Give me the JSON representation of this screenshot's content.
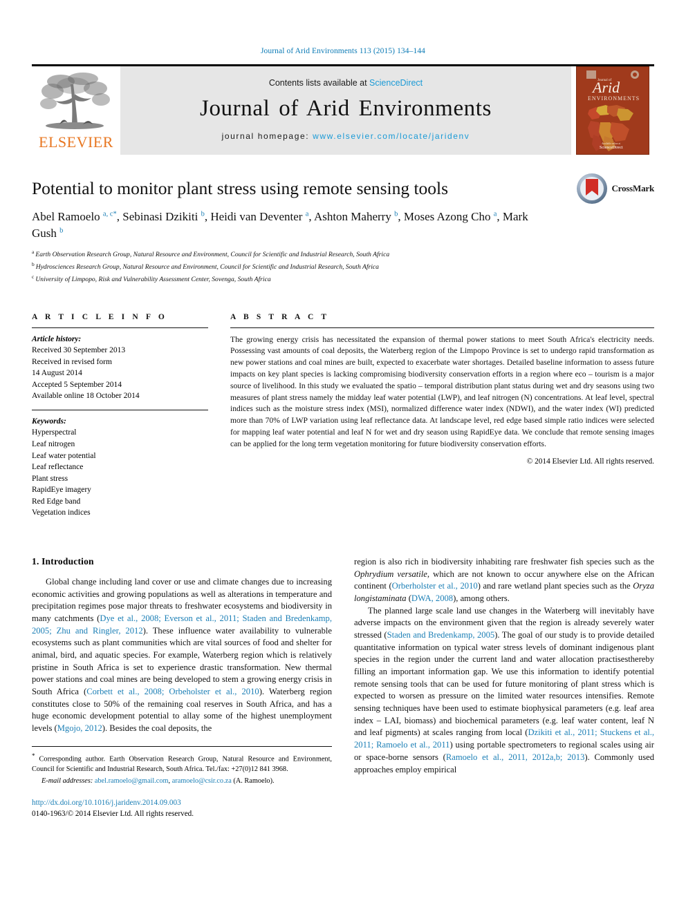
{
  "running_head": "Journal of Arid Environments 113 (2015) 134–144",
  "masthead": {
    "publisher_name": "ELSEVIER",
    "contents_prefix": "Contents lists available at ",
    "contents_link": "ScienceDirect",
    "journal_title": "Journal of Arid Environments",
    "homepage_label": "journal homepage: ",
    "homepage_url": "www.elsevier.com/locate/jaridenv",
    "cover": {
      "journal_word_top": "Journal of",
      "journal_word_main": "Arid",
      "journal_word_sub": "ENVIRONMENTS",
      "bg_color": "#a03a1c"
    }
  },
  "article": {
    "title": "Potential to monitor plant stress using remote sensing tools",
    "authors": [
      {
        "name": "Abel Ramoelo",
        "marks": "a, c",
        "star": "*",
        "sep": ", "
      },
      {
        "name": "Sebinasi Dzikiti",
        "marks": "b",
        "star": "",
        "sep": ", "
      },
      {
        "name": "Heidi van Deventer",
        "marks": "a",
        "star": "",
        "sep": ", "
      },
      {
        "name": "Ashton Maherry",
        "marks": "b",
        "star": "",
        "sep": ", "
      },
      {
        "name": "Moses Azong Cho",
        "marks": "a",
        "star": "",
        "sep": ", "
      },
      {
        "name": "Mark Gush",
        "marks": "b",
        "star": "",
        "sep": ""
      }
    ],
    "affiliations": [
      {
        "mark": "a",
        "text": "Earth Observation Research Group, Natural Resource and Environment, Council for Scientific and Industrial Research, South Africa"
      },
      {
        "mark": "b",
        "text": "Hydrosciences Research Group, Natural Resource and Environment, Council for Scientific and Industrial Research, South Africa"
      },
      {
        "mark": "c",
        "text": "University of Limpopo, Risk and Vulnerability Assessment Center, Sovenga, South Africa"
      }
    ],
    "crossmark_label": "CrossMark"
  },
  "article_info": {
    "heading": "A R T I C L E   I N F O",
    "history_label": "Article history:",
    "history": [
      "Received 30 September 2013",
      "Received in revised form",
      "14 August 2014",
      "Accepted 5 September 2014",
      "Available online 18 October 2014"
    ],
    "keywords_label": "Keywords:",
    "keywords": [
      "Hyperspectral",
      "Leaf nitrogen",
      "Leaf water potential",
      "Leaf reflectance",
      "Plant stress",
      "RapidEye imagery",
      "Red Edge band",
      "Vegetation indices"
    ]
  },
  "abstract": {
    "heading": "A B S T R A C T",
    "text": "The growing energy crisis has necessitated the expansion of thermal power stations to meet South Africa's electricity needs. Possessing vast amounts of coal deposits, the Waterberg region of the Limpopo Province is set to undergo rapid transformation as new power stations and coal mines are built, expected to exacerbate water shortages. Detailed baseline information to assess future impacts on key plant species is lacking compromising biodiversity conservation efforts in a region where eco – tourism is a major source of livelihood. In this study we evaluated the spatio – temporal distribution plant status during wet and dry seasons using two measures of plant stress namely the midday leaf water potential (LWP), and leaf nitrogen (N) concentrations. At leaf level, spectral indices such as the moisture stress index (MSI), normalized difference water index (NDWI), and the water index (WI) predicted more than 70% of LWP variation using leaf reflectance data. At landscape level, red edge based simple ratio indices were selected for mapping leaf water potential and leaf N for wet and dry season using RapidEye data. We conclude that remote sensing images can be applied for the long term vegetation monitoring for future biodiversity conservation efforts.",
    "copyright": "© 2014 Elsevier Ltd. All rights reserved."
  },
  "body": {
    "section_number_title": "1. Introduction",
    "left_paragraphs": [
      {
        "segments": [
          {
            "t": "Global change including land cover or use and climate changes due to increasing economic activities and growing populations as well as alterations in temperature and precipitation regimes pose major threats to freshwater ecosystems and biodiversity in many catchments (",
            "k": "plain"
          },
          {
            "t": "Dye et al., 2008; Everson et al., 2011; Staden and Bredenkamp, 2005; Zhu and Ringler, 2012",
            "k": "cite"
          },
          {
            "t": "). These influence water availability to vulnerable ecosystems such as plant communities which are vital sources of food and shelter for animal, bird, and aquatic species. For example, Waterberg region which is relatively pristine in South Africa is set to experience drastic transformation. New thermal power stations and coal mines are being developed to stem a growing energy crisis in South Africa (",
            "k": "plain"
          },
          {
            "t": "Corbett et al., 2008; Orbeholster et al., 2010",
            "k": "cite"
          },
          {
            "t": "). Waterberg region constitutes close to 50% of the remaining coal reserves in South Africa, and has a huge economic development potential to allay some of the highest unemployment levels (",
            "k": "plain"
          },
          {
            "t": "Mgojo, 2012",
            "k": "cite"
          },
          {
            "t": "). Besides the coal deposits, the",
            "k": "plain"
          }
        ]
      }
    ],
    "right_paragraphs": [
      {
        "segments": [
          {
            "t": "region is also rich in biodiversity inhabiting rare freshwater fish species such as the ",
            "k": "plain"
          },
          {
            "t": "Ophrydium versatile",
            "k": "italic"
          },
          {
            "t": ", which are not known to occur anywhere else on the African continent (",
            "k": "plain"
          },
          {
            "t": "Orberholster et al., 2010",
            "k": "cite"
          },
          {
            "t": ") and rare wetland plant species such as the ",
            "k": "plain"
          },
          {
            "t": "Oryza longistaminata",
            "k": "italic"
          },
          {
            "t": " (",
            "k": "plain"
          },
          {
            "t": "DWA, 2008",
            "k": "cite"
          },
          {
            "t": "), among others.",
            "k": "plain"
          }
        ],
        "indent": false
      },
      {
        "segments": [
          {
            "t": "The planned large scale land use changes in the Waterberg will inevitably have adverse impacts on the environment given that the region is already severely water stressed (",
            "k": "plain"
          },
          {
            "t": "Staden and Bredenkamp, 2005",
            "k": "cite"
          },
          {
            "t": "). The goal of our study is to provide detailed quantitative information on typical water stress levels of dominant indigenous plant species in the region under the current land and water allocation practisesthereby filling an important information gap. We use this information to identify potential remote sensing tools that can be used for future monitoring of plant stress which is expected to worsen as pressure on the limited water resources intensifies. Remote sensing techniques have been used to estimate biophysical parameters (e.g. leaf area index – LAI, biomass) and biochemical parameters (e.g. leaf water content, leaf N and leaf pigments) at scales ranging from local (",
            "k": "plain"
          },
          {
            "t": "Dzikiti et al., 2011; Stuckens et al., 2011; Ramoelo et al., 2011",
            "k": "cite"
          },
          {
            "t": ") using portable spectrometers to regional scales using air or space-borne sensors (",
            "k": "plain"
          },
          {
            "t": "Ramoelo et al., 2011, 2012a,b; 2013",
            "k": "cite"
          },
          {
            "t": "). Commonly used approaches employ empirical",
            "k": "plain"
          }
        ],
        "indent": true
      }
    ]
  },
  "footnotes": {
    "corresponding": "Corresponding author. Earth Observation Research Group, Natural Resource and Environment, Council for Scientific and Industrial Research, South Africa. Tel./fax: +27(0)12 841 3968.",
    "email_label": "E-mail addresses:",
    "email_1": "abel.ramoelo@gmail.com",
    "email_2": "aramoelo@csir.co.za",
    "email_suffix": "(A. Ramoelo).",
    "doi_url": "http://dx.doi.org/10.1016/j.jaridenv.2014.09.003",
    "issn_line": "0140-1963/© 2014 Elsevier Ltd. All rights reserved."
  },
  "colors": {
    "link": "#1a7eb5",
    "sciencedirect": "#1a9ad6",
    "elsevier_orange": "#E87722",
    "masthead_bg": "#e6e6e6"
  }
}
